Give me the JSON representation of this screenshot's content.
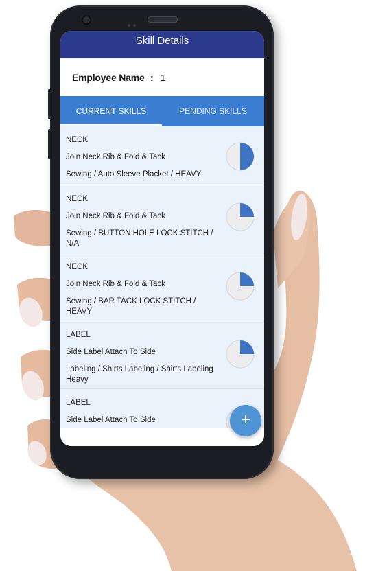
{
  "app": {
    "title": "Skill Details",
    "accent_color": "#2b3a8c",
    "tab_color": "#3b7dd0"
  },
  "employee": {
    "label": "Employee Name",
    "separator": ":",
    "value": "1"
  },
  "tabs": [
    {
      "label": "CURRENT SKILLS",
      "selected": true
    },
    {
      "label": "PENDING SKILLS",
      "selected": false
    }
  ],
  "skills": [
    {
      "category": "NECK",
      "operation": "Join Neck Rib & Fold & Tack",
      "machine": "Sewing / Auto Sleeve Placket / HEAVY",
      "progress": 0.5
    },
    {
      "category": "NECK",
      "operation": "Join Neck Rib & Fold & Tack",
      "machine": "Sewing / BUTTON HOLE LOCK STITCH / N/A",
      "progress": 0.25
    },
    {
      "category": "NECK",
      "operation": "Join Neck Rib & Fold & Tack",
      "machine": "Sewing / BAR TACK LOCK STITCH / HEAVY",
      "progress": 0.25
    },
    {
      "category": "LABEL",
      "operation": "Side Label Attach To Side",
      "machine": "Labeling / Shirts Labeling / Shirts Labeling Heavy",
      "progress": 0.25
    },
    {
      "category": "LABEL",
      "operation": "Side Label Attach To Side",
      "machine": "",
      "progress": 0.25
    }
  ],
  "fab": {
    "icon": "plus-icon",
    "glyph": "+"
  }
}
